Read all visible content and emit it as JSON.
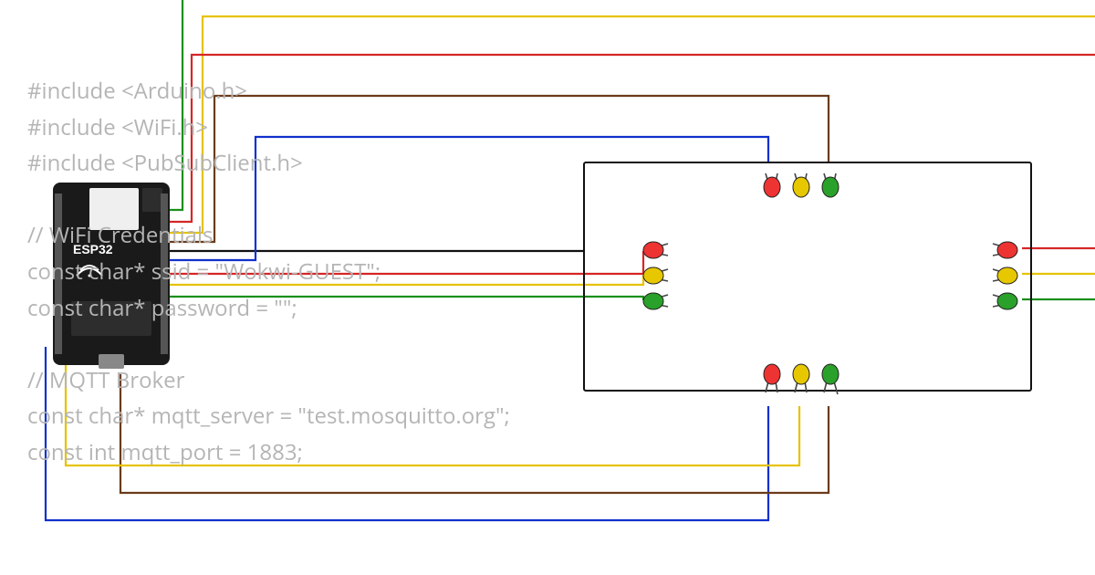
{
  "board": {
    "label": "ESP32"
  },
  "code": {
    "line1": "#include <Arduino.h>",
    "line2": "#include <WiFi.h>",
    "line3": "#include <PubSubClient.h>",
    "line4": "",
    "line5": "// WiFi Credentials",
    "line6": "const char* ssid = \"Wokwi-GUEST\";",
    "line7": "const char* password = \"\";",
    "line8": "",
    "line9": "// MQTT Broker",
    "line10": "const char* mqtt_server = \"test.mosquitto.org\";",
    "line11": "const int mqtt_port = 1883;"
  },
  "traffic_lights": {
    "top": {
      "leds": [
        "red",
        "yellow",
        "green"
      ]
    },
    "left": {
      "leds": [
        "red",
        "yellow",
        "green"
      ]
    },
    "right": {
      "leds": [
        "red",
        "yellow",
        "green"
      ]
    },
    "bottom": {
      "leds": [
        "red",
        "yellow",
        "green"
      ]
    }
  },
  "wire_colors": [
    "green",
    "yellow",
    "red",
    "black",
    "blue",
    "brown"
  ]
}
